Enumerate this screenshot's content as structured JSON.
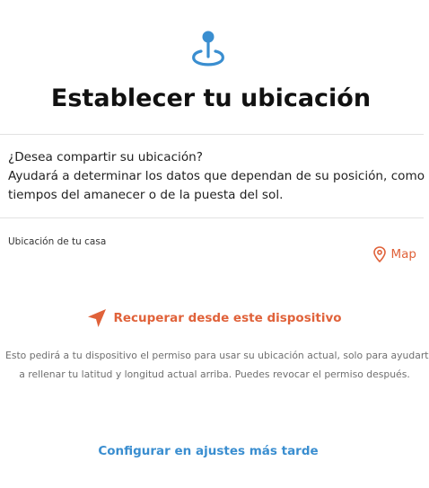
{
  "header": {
    "icon": "location-pin-icon",
    "title": "Establecer tu ubicación"
  },
  "intro": {
    "question": "¿Desea compartir su ubicación?",
    "description_line1": "Ayudará a determinar los datos que dependan de su posición, como los",
    "description_line2": "tiempos del amanecer o de la puesta del sol."
  },
  "home_location": {
    "label": "Ubicación de tu casa",
    "map_link": "Map",
    "map_icon": "map-pin-icon"
  },
  "device": {
    "button_label": "Recuperar desde este dispositivo",
    "button_icon": "navigation-arrow-icon",
    "hint_line1": "Esto pedirá a tu dispositivo el permiso para usar su ubicación actual, solo para ayudarte",
    "hint_line2": "a rellenar tu latitud y longitud actual arriba. Puedes revocar el permiso después."
  },
  "footer": {
    "later_label": "Configurar en ajustes más tarde"
  },
  "colors": {
    "accent_blue": "#3a8ed0",
    "accent_orange": "#e0623a",
    "title_text": "#111111",
    "hint_text": "#6f6f6f"
  }
}
